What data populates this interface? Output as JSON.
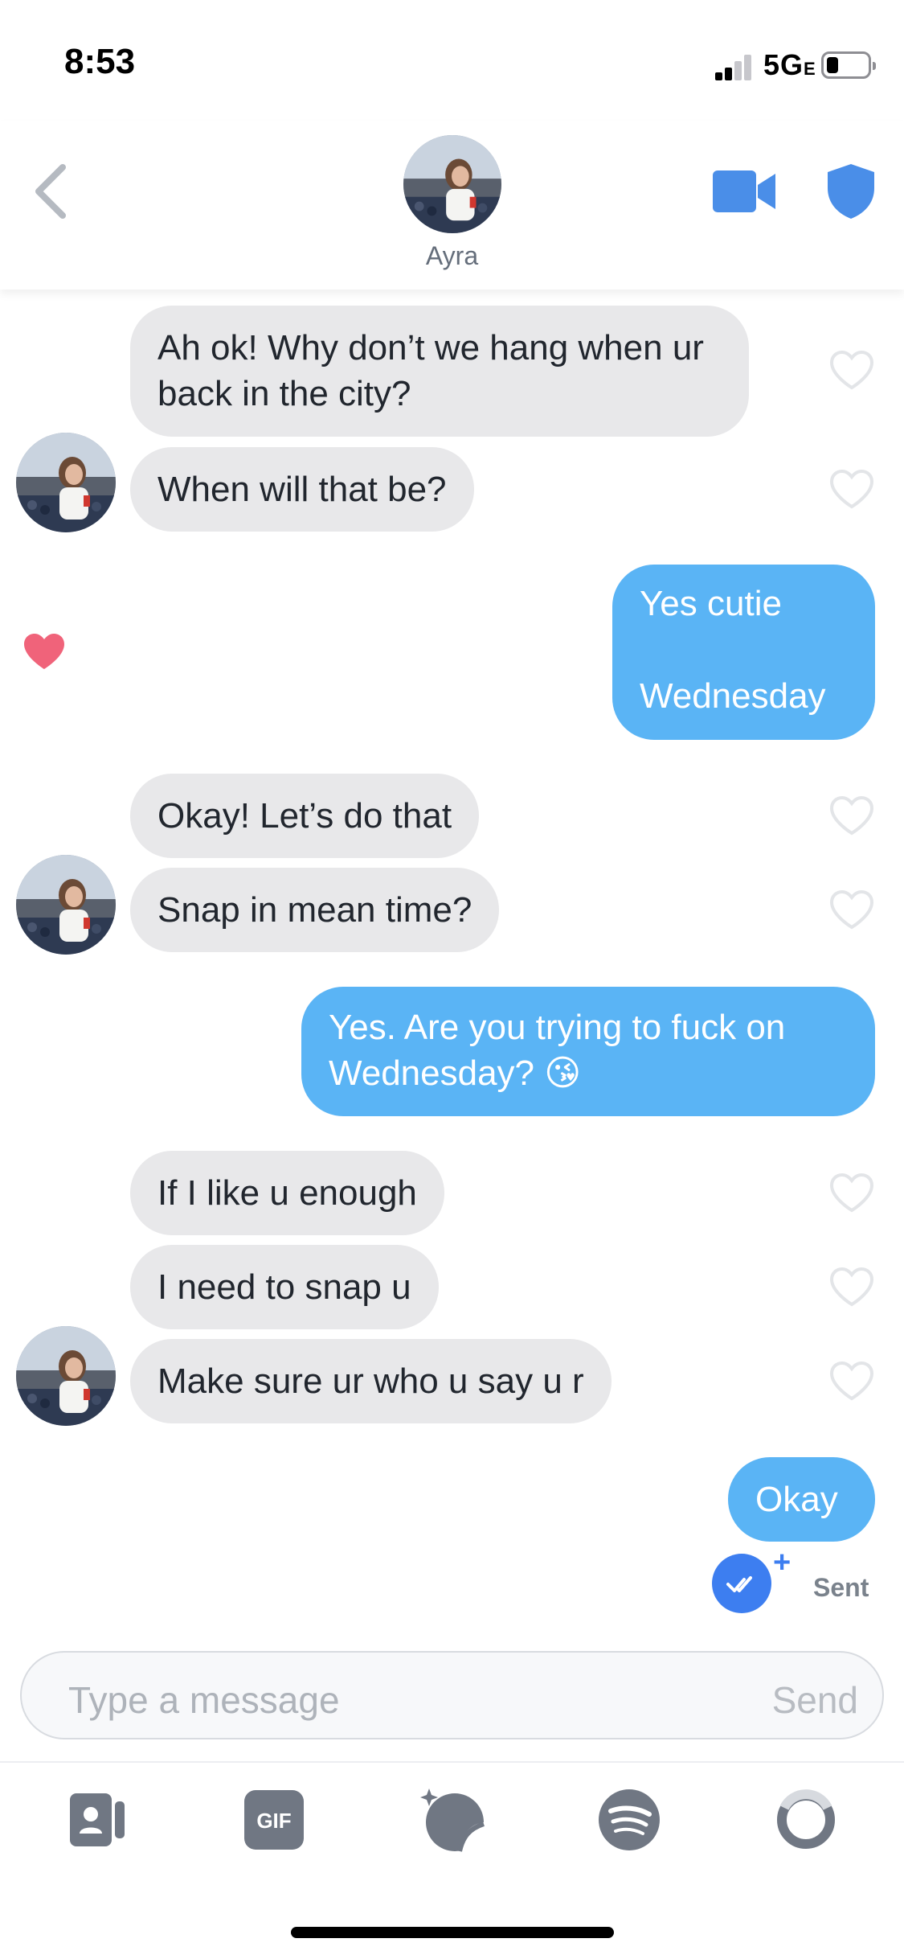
{
  "status_bar": {
    "time": "8:53",
    "network": "5G",
    "network_suffix": "E",
    "battery_level": 0.3
  },
  "header": {
    "contact_name": "Ayra",
    "accent_color": "#4a8ee8"
  },
  "messages": [
    {
      "from": "them",
      "text": "Ah ok! Why don’t we hang when ur back in the city?",
      "liked": false
    },
    {
      "from": "them",
      "text": "When will that be?",
      "liked": false
    },
    {
      "from": "me",
      "text_line1": "Yes cutie",
      "text_line2": "Wednesday",
      "liked_by_them": true
    },
    {
      "from": "them",
      "text": "Okay! Let’s do that",
      "liked": false
    },
    {
      "from": "them",
      "text": "Snap in mean time?",
      "liked": false
    },
    {
      "from": "me",
      "text": "Yes. Are you trying to fuck on Wednesday? 😘"
    },
    {
      "from": "them",
      "text": "If I like u enough",
      "liked": false
    },
    {
      "from": "them",
      "text": "I need to snap u",
      "liked": false
    },
    {
      "from": "them",
      "text": "Make sure ur who u say u r",
      "liked": false
    },
    {
      "from": "me",
      "text": "Okay"
    }
  ],
  "read_receipt": {
    "plus": "+",
    "status": "Sent"
  },
  "composer": {
    "placeholder": "Type a message",
    "send_label": "Send"
  },
  "toolbar": {
    "gif_label": "GIF",
    "icons": [
      "contact-card-icon",
      "gif-icon",
      "sticker-icon",
      "spotify-icon",
      "loop-icon"
    ]
  },
  "colors": {
    "incoming_bubble": "#e8e8ea",
    "outgoing_bubble": "#5ab4f5",
    "heart_liked": "#f0637a",
    "sent_check": "#3d7ef0"
  }
}
